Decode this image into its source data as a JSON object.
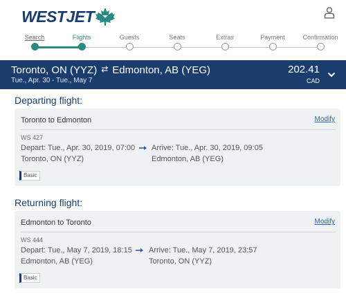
{
  "brand": {
    "name": "WESTJET",
    "color": "#1b3d6d",
    "leaf_color": "#2a8a82"
  },
  "header": {
    "account_icon": "person-icon"
  },
  "stepper": {
    "steps": [
      {
        "label": "Search",
        "state": "done"
      },
      {
        "label": "Flights",
        "state": "current"
      },
      {
        "label": "Guests",
        "state": "todo"
      },
      {
        "label": "Seats",
        "state": "todo"
      },
      {
        "label": "Extras",
        "state": "todo"
      },
      {
        "label": "Payment",
        "state": "todo"
      },
      {
        "label": "Confirmation",
        "state": "todo"
      }
    ]
  },
  "trip": {
    "origin": "Toronto, ON (YYZ)",
    "destination": "Edmonton, AB (YEG)",
    "swap_icon": "swap-arrows-icon",
    "dates": "Tue., Apr. 30 - Tue., May 7",
    "price": "202.41",
    "currency": "CAD",
    "expand_icon": "chevron-down-icon"
  },
  "departing": {
    "section_title": "Departing flight:",
    "route": "Toronto to Edmonton",
    "modify_label": "Modify",
    "flight_number": "WS 427",
    "depart": "Depart: Tue., Apr. 30, 2019, 07:00",
    "depart_airport": "Toronto, ON (YYZ)",
    "arrive": "Arrive: Tue., Apr. 30, 2019, 09:05",
    "arrive_airport": "Edmonton, AB (YEG)",
    "fare": "Basic"
  },
  "returning": {
    "section_title": "Returning flight:",
    "route": "Edmonton to Toronto",
    "modify_label": "Modify",
    "flight_number": "WS 444",
    "depart": "Depart: Tue., May 7, 2019, 18:15",
    "depart_airport": "Edmonton, AB (YEG)",
    "arrive": "Arrive: Tue., May 7, 2019, 23:57",
    "arrive_airport": "Toronto, ON (YYZ)",
    "fare": "Basic"
  }
}
